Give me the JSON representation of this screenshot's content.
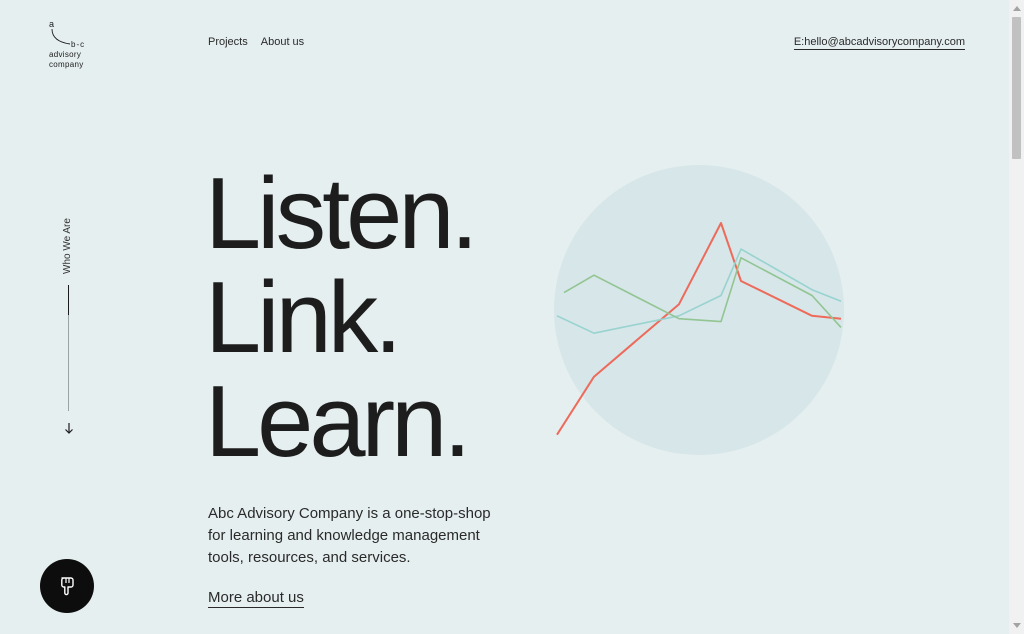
{
  "logo": {
    "a": "a",
    "bc": "b-c",
    "line1": "advisory",
    "line2": "company"
  },
  "nav": {
    "items": [
      "Projects",
      "About us"
    ]
  },
  "contact": {
    "email": "E:hello@abcadvisorycompany.com"
  },
  "side": {
    "label": "Who We Are",
    "arrow_icon": "arrow-down-icon"
  },
  "hero": {
    "line1": "Listen.",
    "line2": "Link.",
    "line3": "Learn."
  },
  "intro": {
    "text": "Abc Advisory Company is a one-stop-shop for learning and knowledge management tools, resources, and services.",
    "link": "More about us"
  },
  "fab": {
    "icon": "pointing-hand-icon"
  },
  "colors": {
    "background": "#e6eff0",
    "circle": "#d6e6e9",
    "red": "#ee6a5a",
    "green": "#92c592",
    "teal": "#98d3cf"
  },
  "chart_data": {
    "type": "line",
    "series": [
      {
        "values": [
          0.07,
          0.27,
          0.52,
          0.8,
          0.6,
          0.48,
          0.47
        ]
      },
      {
        "values": [
          0.48,
          0.42,
          0.48,
          0.55,
          0.71,
          0.57,
          0.53
        ]
      },
      {
        "values": [
          0.56,
          0.62,
          0.47,
          0.46,
          0.68,
          0.55,
          0.44
        ]
      }
    ]
  }
}
